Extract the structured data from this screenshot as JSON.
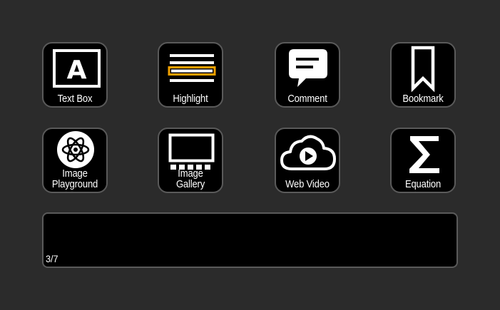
{
  "tiles": [
    {
      "label": "Text Box",
      "icon": "text-box-icon"
    },
    {
      "label": "Highlight",
      "icon": "highlight-icon"
    },
    {
      "label": "Comment",
      "icon": "comment-icon"
    },
    {
      "label": "Bookmark",
      "icon": "bookmark-icon"
    },
    {
      "label_line1": "Image",
      "label_line2": "Playground",
      "icon": "atom-icon"
    },
    {
      "label_line1": "Image",
      "label_line2": "Gallery",
      "icon": "gallery-icon"
    },
    {
      "label": "Web Video",
      "icon": "cloud-play-icon"
    },
    {
      "label": "Equation",
      "icon": "sigma-icon"
    }
  ],
  "strip": {
    "page_counter": "3/7"
  },
  "colors": {
    "background": "#2b2b2b",
    "tile": "#000000",
    "border": "#5a5a5a",
    "highlight_accent": "#f0a000"
  }
}
